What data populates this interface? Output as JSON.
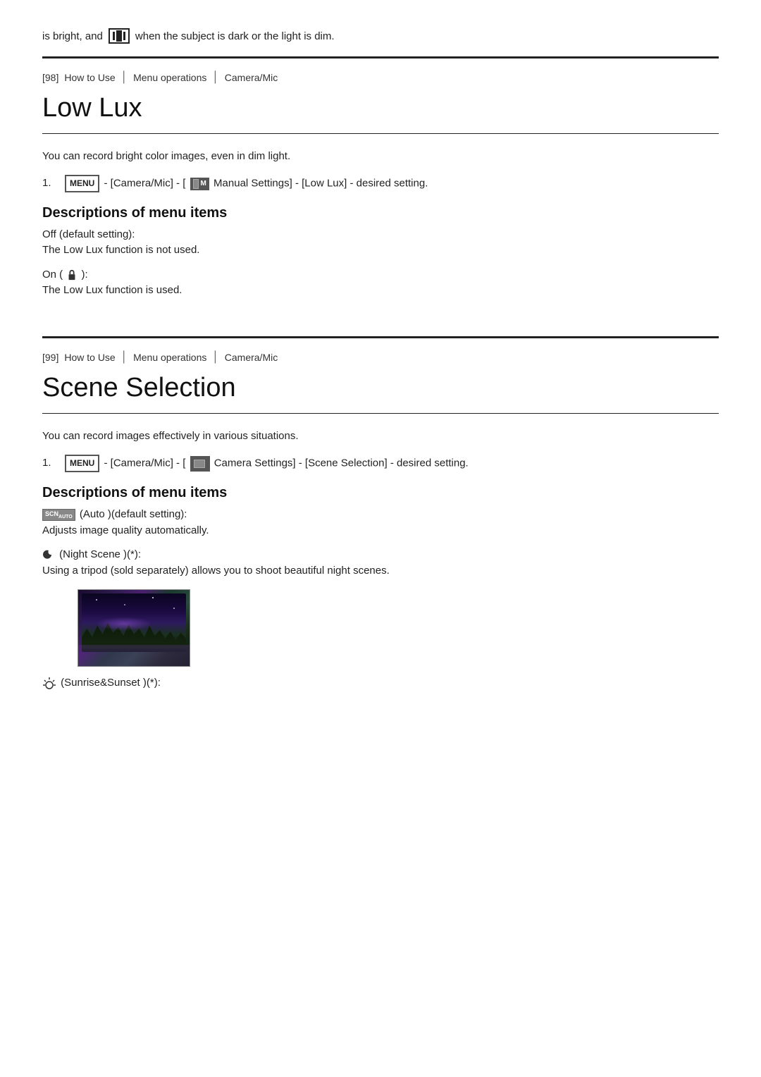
{
  "top": {
    "intro_text_before": "is bright, and",
    "intro_text_after": "when the subject is dark or the light is dim."
  },
  "section98": {
    "breadcrumb": {
      "number": "[98]",
      "part1": "How to Use",
      "sep1": "|",
      "part2": "Menu operations",
      "sep2": "|",
      "part3": "Camera/Mic"
    },
    "title": "Low Lux",
    "intro": "You can record bright color images, even in dim light.",
    "step1": "- [Camera/Mic] - [",
    "step1_mid": "Manual Settings] - [Low Lux] - desired setting.",
    "descriptions_title": "Descriptions of menu items",
    "items": [
      {
        "label": "Off  (default setting):",
        "desc": "The Low Lux function is not used."
      },
      {
        "label": "On ( ):",
        "desc": "The Low Lux function is used."
      }
    ]
  },
  "section99": {
    "breadcrumb": {
      "number": "[99]",
      "part1": "How to Use",
      "sep1": "|",
      "part2": "Menu operations",
      "sep2": "|",
      "part3": "Camera/Mic"
    },
    "title": "Scene Selection",
    "intro": "You can record images effectively in various situations.",
    "step1_prefix": "- [Camera/Mic] - [",
    "step1_suffix": "Camera Settings] - [Scene Selection] - desired setting.",
    "descriptions_title": "Descriptions of menu items",
    "items": [
      {
        "label": "(Auto  )(default setting):",
        "desc": "Adjusts image quality automatically."
      },
      {
        "label": "(Night Scene    )(*):",
        "desc": "Using a tripod (sold separately) allows you to shoot beautiful night scenes."
      },
      {
        "label": "(Sunrise&Sunset    )(*):",
        "desc": ""
      }
    ]
  },
  "menu_label": "MENU"
}
